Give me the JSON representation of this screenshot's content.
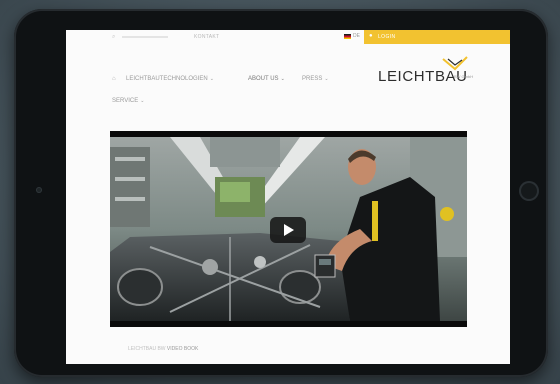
{
  "topbar": {
    "language": "DE",
    "login_label": "LOGIN",
    "ghost_text": "KONTAKT"
  },
  "nav": {
    "items": [
      {
        "label": "LEICHTBAUTECHNOLOGIEN"
      },
      {
        "label": "ABOUT US"
      },
      {
        "label": "PRESS"
      },
      {
        "label": "SERVICE"
      }
    ]
  },
  "logo": {
    "text": "LEICHTBAU",
    "sub": "BW GmbH"
  },
  "video": {
    "play_icon": "play-icon"
  },
  "caption": {
    "prefix": "LEICHTBAU BW",
    "link": "VIDEO BOOK"
  },
  "colors": {
    "accent": "#f2c230",
    "screen_bg": "#fbfbfb",
    "bezel": "#0f1214"
  }
}
